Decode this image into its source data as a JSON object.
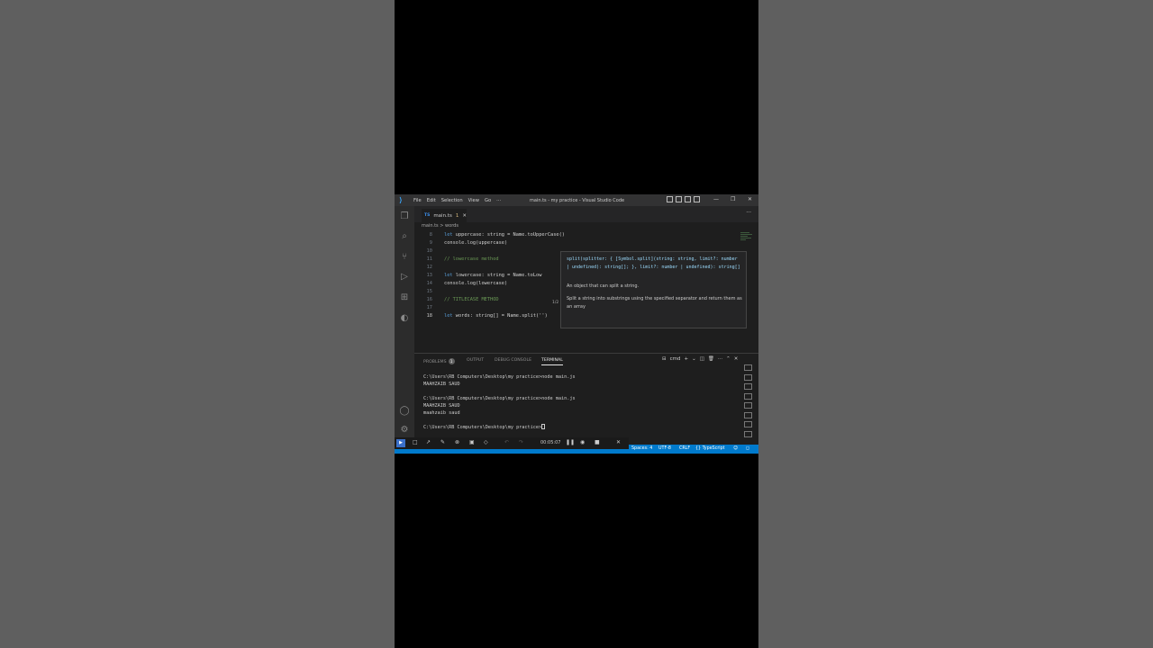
{
  "window": {
    "title": "main.ts - my practice - Visual Studio Code",
    "menu": [
      "File",
      "Edit",
      "Selection",
      "View",
      "Go",
      "···"
    ],
    "controls": {
      "minimize": "—",
      "restore": "❐",
      "close": "✕"
    }
  },
  "activity_bar": [
    "explorer-icon",
    "search-icon",
    "source-control-icon",
    "run-debug-icon",
    "extensions-icon",
    "edge-icon",
    "account-icon",
    "settings-icon"
  ],
  "tabs": [
    {
      "type": "TS",
      "label": "main.ts",
      "modified": "1",
      "close": "✕"
    }
  ],
  "tabs_more": "···",
  "breadcrumb": {
    "file": "main.ts",
    "separator": ">",
    "symbol": "words"
  },
  "editor": {
    "lines": [
      {
        "num": "8",
        "kw": "let",
        "text": " uppercase: string = Name.toUpperCase()"
      },
      {
        "num": "9",
        "kw": "",
        "text": "console.log(uppercase)"
      },
      {
        "num": "10",
        "kw": "",
        "text": ""
      },
      {
        "num": "11",
        "kw": "",
        "comment": "// lowercase method"
      },
      {
        "num": "12",
        "kw": "",
        "text": ""
      },
      {
        "num": "13",
        "kw": "let",
        "text": " lowercase: string = Name.toLow"
      },
      {
        "num": "14",
        "kw": "",
        "text": "console.log(lowercase)"
      },
      {
        "num": "15",
        "kw": "",
        "text": ""
      },
      {
        "num": "16",
        "kw": "",
        "comment": "// TITLECASE METHOD"
      },
      {
        "num": "17",
        "kw": "",
        "text": ""
      },
      {
        "num": "18",
        "kw": "let",
        "text": " words: string[] = Name.split('')"
      }
    ]
  },
  "hover": {
    "signature": "split(splitter: { [Symbol.split](string: string, limit?: number | undefined): string[]; }, limit?: number | undefined): string[]",
    "param_desc": "An object that can split a string.",
    "desc": "Split a string into substrings using the specified separator and return them as an array",
    "counter": "1/2"
  },
  "panel": {
    "tabs": [
      "PROBLEMS",
      "OUTPUT",
      "DEBUG CONSOLE",
      "TERMINAL"
    ],
    "problems_count": "1",
    "shell": "cmd",
    "terminal_lines": [
      "",
      "C:\\Users\\RB Computers\\Desktop\\my practice>node main.js",
      "MAAHZAIB SAUD",
      "",
      "C:\\Users\\RB Computers\\Desktop\\my practice>node main.js",
      "MAAHZAIB SAUD",
      "maahzaib saud",
      "",
      "C:\\Users\\RB Computers\\Desktop\\my practice>"
    ]
  },
  "recorder": {
    "time": "00:05:07"
  },
  "statusbar": {
    "spaces": "Spaces: 4",
    "encoding": "UTF-8",
    "eol": "CRLF",
    "language": "{} TypeScript"
  }
}
